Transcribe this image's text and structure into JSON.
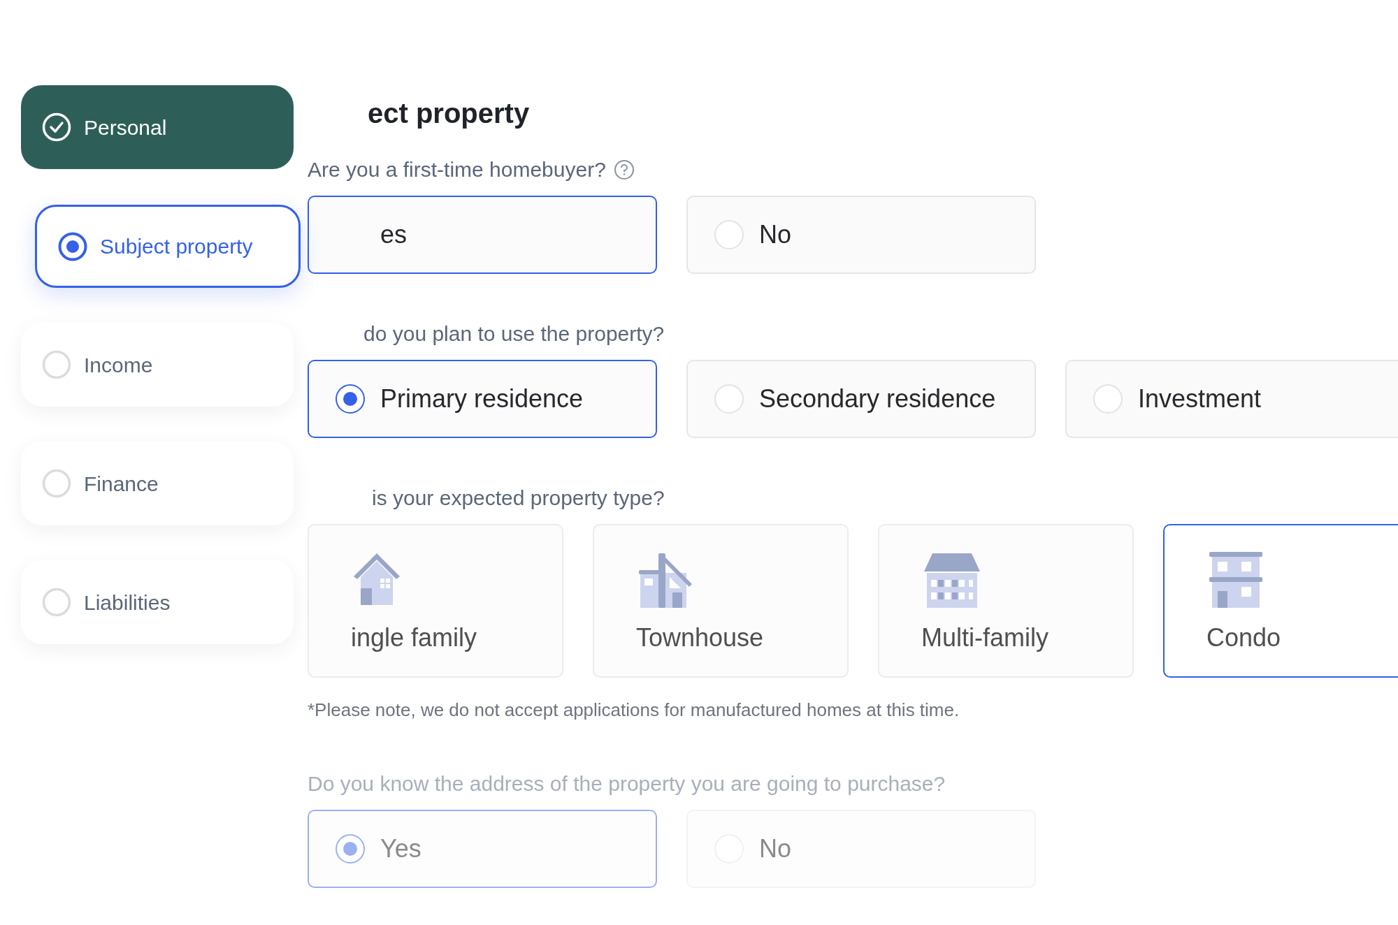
{
  "sidebar": {
    "steps": [
      {
        "label": "Personal",
        "completed": true,
        "selected": false
      },
      {
        "label": "Subject property",
        "completed": false,
        "selected": true
      },
      {
        "label": "Income",
        "completed": false,
        "selected": false
      },
      {
        "label": "Finance",
        "completed": false,
        "selected": false
      },
      {
        "label": "Liabilities",
        "completed": false,
        "selected": false
      }
    ]
  },
  "heading": "ect property",
  "questions": [
    {
      "kind": "choice",
      "text": "Are you a first-time homebuyer?",
      "help": true,
      "disabled": false,
      "options": [
        {
          "label": "es",
          "selected": true
        },
        {
          "label": "No",
          "selected": false
        }
      ]
    },
    {
      "kind": "choice",
      "text": "do you plan to use the property?",
      "help": false,
      "disabled": false,
      "options": [
        {
          "label": "Primary residence",
          "selected": true
        },
        {
          "label": "Secondary residence",
          "selected": false
        },
        {
          "label": "Investment",
          "selected": false
        }
      ]
    },
    {
      "kind": "tiles",
      "text": "is your expected property type?",
      "help": false,
      "disabled": false,
      "options": [
        {
          "label": "ingle family",
          "kind": "house",
          "selected": false
        },
        {
          "label": "Townhouse",
          "kind": "townhouse",
          "selected": false
        },
        {
          "label": "Multi-family",
          "kind": "multi",
          "selected": false
        },
        {
          "label": "Condo",
          "kind": "condo",
          "selected": true
        }
      ],
      "note": "*Please note, we do not accept applications for manufactured homes at this time."
    },
    {
      "kind": "choice",
      "text": "Do you know the address of the property you are going to purchase?",
      "help": false,
      "disabled": true,
      "options": [
        {
          "label": "Yes",
          "selected": true
        },
        {
          "label": "No",
          "selected": false
        }
      ]
    }
  ]
}
